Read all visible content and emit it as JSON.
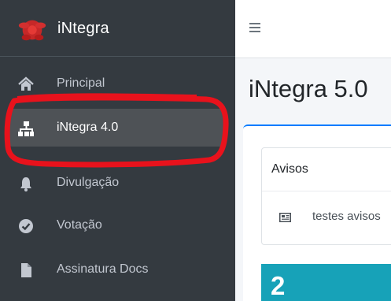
{
  "brand": {
    "name": "iNtegra",
    "logo_icon": "red-splash-logo-icon"
  },
  "sidebar": {
    "items": [
      {
        "label": "Principal",
        "icon": "home-icon"
      },
      {
        "label": "iNtegra 4.0",
        "icon": "sitemap-icon",
        "active": true
      },
      {
        "label": "Divulgação",
        "icon": "bell-icon"
      },
      {
        "label": "Votação",
        "icon": "check-circle-icon"
      },
      {
        "label": "Assinatura Docs",
        "icon": "file-icon"
      }
    ]
  },
  "topbar": {
    "menu_icon": "hamburger-icon"
  },
  "main": {
    "page_title": "iNtegra 5.0",
    "avisos": {
      "title": "Avisos",
      "items": [
        {
          "icon": "newspaper-icon",
          "text": "testes avisos"
        }
      ]
    },
    "stat": {
      "value": "2",
      "color": "#17a2b8"
    }
  },
  "colors": {
    "sidebar_bg": "#343a40",
    "sidebar_text": "#c2c7d0",
    "active_bg": "#4e5256",
    "accent": "#007bff",
    "annotation": "#e8121c"
  }
}
